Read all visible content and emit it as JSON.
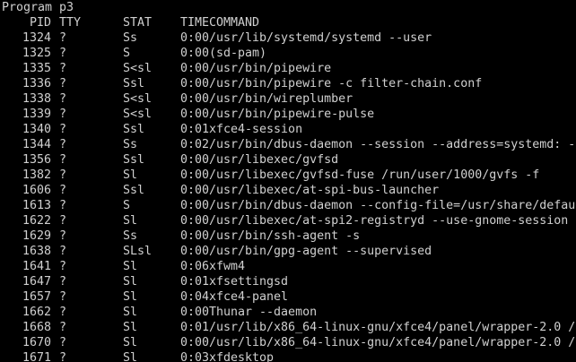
{
  "window": {
    "title": "Program p3"
  },
  "colors": {
    "background": "#000000",
    "foreground": "#d0d0d0"
  },
  "table": {
    "columns": [
      "PID",
      "TTY",
      "STAT",
      "TIME",
      "COMMAND"
    ],
    "rows": [
      {
        "pid": "1324",
        "tty": "?",
        "stat": "Ss",
        "time": "0:00",
        "command": "/usr/lib/systemd/systemd --user"
      },
      {
        "pid": "1325",
        "tty": "?",
        "stat": "S",
        "time": "0:00",
        "command": "(sd-pam)"
      },
      {
        "pid": "1335",
        "tty": "?",
        "stat": "S<sl",
        "time": "0:00",
        "command": "/usr/bin/pipewire"
      },
      {
        "pid": "1336",
        "tty": "?",
        "stat": "Ssl",
        "time": "0:00",
        "command": "/usr/bin/pipewire -c filter-chain.conf"
      },
      {
        "pid": "1338",
        "tty": "?",
        "stat": "S<sl",
        "time": "0:00",
        "command": "/usr/bin/wireplumber"
      },
      {
        "pid": "1339",
        "tty": "?",
        "stat": "S<sl",
        "time": "0:00",
        "command": "/usr/bin/pipewire-pulse"
      },
      {
        "pid": "1340",
        "tty": "?",
        "stat": "Ssl",
        "time": "0:01",
        "command": "xfce4-session"
      },
      {
        "pid": "1344",
        "tty": "?",
        "stat": "Ss",
        "time": "0:02",
        "command": "/usr/bin/dbus-daemon --session --address=systemd: --"
      },
      {
        "pid": "1356",
        "tty": "?",
        "stat": "Ssl",
        "time": "0:00",
        "command": "/usr/libexec/gvfsd"
      },
      {
        "pid": "1382",
        "tty": "?",
        "stat": "Sl",
        "time": "0:00",
        "command": "/usr/libexec/gvfsd-fuse /run/user/1000/gvfs -f"
      },
      {
        "pid": "1606",
        "tty": "?",
        "stat": "Ssl",
        "time": "0:00",
        "command": "/usr/libexec/at-spi-bus-launcher"
      },
      {
        "pid": "1613",
        "tty": "?",
        "stat": "S",
        "time": "0:00",
        "command": "/usr/bin/dbus-daemon --config-file=/usr/share/defau"
      },
      {
        "pid": "1622",
        "tty": "?",
        "stat": "Sl",
        "time": "0:00",
        "command": "/usr/libexec/at-spi2-registryd --use-gnome-session"
      },
      {
        "pid": "1629",
        "tty": "?",
        "stat": "Ss",
        "time": "0:00",
        "command": "/usr/bin/ssh-agent -s"
      },
      {
        "pid": "1638",
        "tty": "?",
        "stat": "SLsl",
        "time": "0:00",
        "command": "/usr/bin/gpg-agent --supervised"
      },
      {
        "pid": "1641",
        "tty": "?",
        "stat": "Sl",
        "time": "0:06",
        "command": "xfwm4"
      },
      {
        "pid": "1647",
        "tty": "?",
        "stat": "Sl",
        "time": "0:01",
        "command": "xfsettingsd"
      },
      {
        "pid": "1657",
        "tty": "?",
        "stat": "Sl",
        "time": "0:04",
        "command": "xfce4-panel"
      },
      {
        "pid": "1662",
        "tty": "?",
        "stat": "Sl",
        "time": "0:00",
        "command": "Thunar --daemon"
      },
      {
        "pid": "1668",
        "tty": "?",
        "stat": "Sl",
        "time": "0:01",
        "command": "/usr/lib/x86_64-linux-gnu/xfce4/panel/wrapper-2.0 /"
      },
      {
        "pid": "1670",
        "tty": "?",
        "stat": "Sl",
        "time": "0:00",
        "command": "/usr/lib/x86_64-linux-gnu/xfce4/panel/wrapper-2.0 /"
      },
      {
        "pid": "1671",
        "tty": "?",
        "stat": "Sl",
        "time": "0:03",
        "command": "xfdesktop"
      }
    ]
  }
}
